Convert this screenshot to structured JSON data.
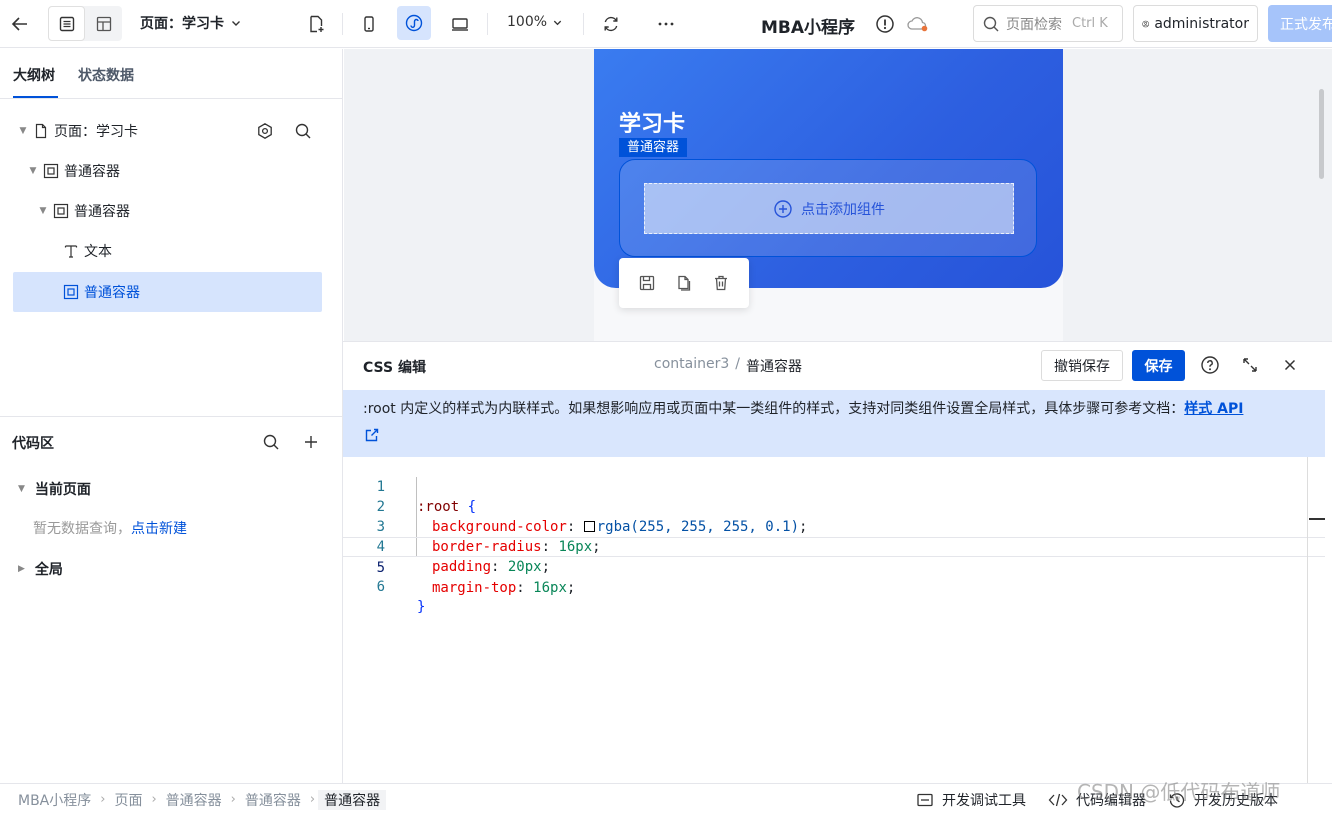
{
  "topbar": {
    "page_select": "页面：学习卡",
    "zoom": "100%",
    "app_title": "MBA小程序",
    "search_placeholder": "页面检索",
    "search_shortcut": "Ctrl K",
    "user": "administrator",
    "publish": "正式发布"
  },
  "left": {
    "tabs": [
      "大纲树",
      "状态数据"
    ],
    "tree": [
      {
        "label": "页面：学习卡",
        "icon": "page-icon"
      },
      {
        "label": "普通容器",
        "icon": "container-icon"
      },
      {
        "label": "普通容器",
        "icon": "container-icon"
      },
      {
        "label": "文本",
        "icon": "text-icon"
      },
      {
        "label": "普通容器",
        "icon": "container-icon"
      }
    ],
    "code_area": {
      "title": "代码区",
      "current_page": "当前页面",
      "empty_text": "暂无数据查询，",
      "create_link": "点击新建",
      "global": "全局"
    }
  },
  "canvas": {
    "card_title": "学习卡",
    "selection_label": "普通容器",
    "add_component": "点击添加组件"
  },
  "editor": {
    "title": "CSS 编辑",
    "breadcrumb": [
      "container3",
      "/",
      "普通容器"
    ],
    "cancel_save": "撤销保存",
    "save": "保存",
    "notice_text": ":root 内定义的样式为内联样式。如果想影响应用或页面中某一类组件的样式，支持对同类组件设置全局样式，具体步骤可参考文档：",
    "notice_link": "样式 API",
    "lines": [
      {
        "n": "1",
        "sel": ":root",
        "brace": " {"
      },
      {
        "n": "2",
        "prop": "background-color",
        "fn": "rgba(255, 255, 255, 0.1)",
        "swatch": true
      },
      {
        "n": "3",
        "prop": "border-radius",
        "val": "16px"
      },
      {
        "n": "4",
        "prop": "padding",
        "val": "20px"
      },
      {
        "n": "5",
        "prop": "margin-top",
        "val": "16px"
      },
      {
        "n": "6",
        "brace": "}"
      }
    ]
  },
  "status": {
    "breadcrumbs": [
      "MBA小程序",
      "页面",
      "普通容器",
      "普通容器",
      "普通容器"
    ],
    "tools": [
      "开发调试工具",
      "代码编辑器",
      "开发历史版本"
    ]
  },
  "watermark": "CSDN @低代码布道师",
  "colors": {
    "primary": "#0052d9",
    "notice_bg": "#d9e6fd",
    "card_gradient_start": "#3a7cf0",
    "card_gradient_end": "#2653d9"
  }
}
